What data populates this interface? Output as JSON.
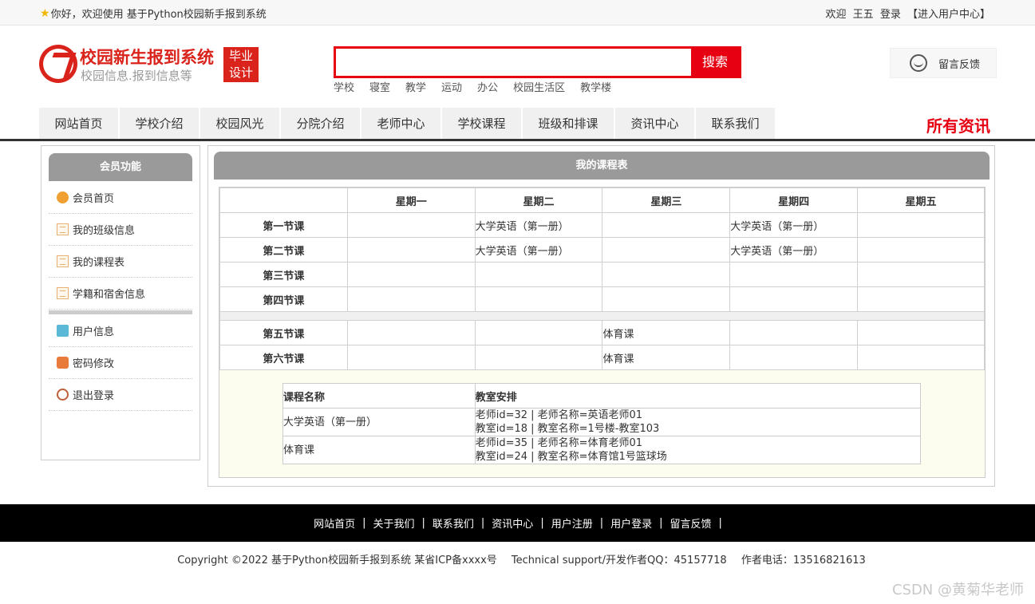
{
  "topbar": {
    "welcome": "你好，欢迎使用 基于Python校园新手报到系统",
    "greeting": "欢迎",
    "username": "王五",
    "login": "登录",
    "user_center": "【进入用户中心】"
  },
  "header": {
    "logo_title": "校园新生报到系统",
    "logo_subtitle": "校园信息.报到信息等",
    "badge_line1": "毕业",
    "badge_line2": "设计",
    "search_value": "",
    "search_button": "搜索",
    "hotwords": [
      "学校",
      "寝室",
      "教学",
      "运动",
      "办公",
      "校园生活区",
      "教学楼"
    ],
    "feedback": "留言反馈"
  },
  "nav": {
    "items": [
      "网站首页",
      "学校介绍",
      "校园风光",
      "分院介绍",
      "老师中心",
      "学校课程",
      "班级和排课",
      "资讯中心",
      "联系我们"
    ],
    "all_news": "所有资讯"
  },
  "sidebar": {
    "title": "会员功能",
    "items": [
      "会员首页",
      "我的班级信息",
      "我的课程表",
      "学籍和宿舍信息",
      "用户信息",
      "密码修改",
      "退出登录"
    ]
  },
  "main": {
    "title": "我的课程表",
    "days": [
      "星期一",
      "星期二",
      "星期三",
      "星期四",
      "星期五"
    ],
    "rows": [
      {
        "label": "第一节课",
        "cells": [
          "",
          "大学英语（第一册）",
          "",
          "大学英语（第一册）",
          ""
        ]
      },
      {
        "label": "第二节课",
        "cells": [
          "",
          "大学英语（第一册）",
          "",
          "大学英语（第一册）",
          ""
        ]
      },
      {
        "label": "第三节课",
        "cells": [
          "",
          "",
          "",
          "",
          ""
        ]
      },
      {
        "label": "第四节课",
        "cells": [
          "",
          "",
          "",
          "",
          ""
        ]
      },
      {
        "label": "第五节课",
        "cells": [
          "",
          "",
          "体育课",
          "",
          ""
        ]
      },
      {
        "label": "第六节课",
        "cells": [
          "",
          "",
          "体育课",
          "",
          ""
        ]
      }
    ],
    "detail_headers": [
      "课程名称",
      "教室安排"
    ],
    "detail_rows": [
      {
        "course": "大学英语（第一册）",
        "line1": "老师id=32 | 老师名称=英语老师01",
        "line2": "教室id=18 | 教室名称=1号楼-教室103"
      },
      {
        "course": "体育课",
        "line1": "老师id=35 | 老师名称=体育老师01",
        "line2": "教室id=24 | 教室名称=体育馆1号篮球场"
      }
    ]
  },
  "footer": {
    "links": [
      "网站首页",
      "关于我们",
      "联系我们",
      "资讯中心",
      "用户注册",
      "用户登录",
      "留言反馈"
    ],
    "separator": "|",
    "copyright": "Copyright ©2022 基于Python校园新手报到系统 某省ICP备xxxx号",
    "support": "Technical support/开发作者QQ：45157718",
    "phone": "作者电话：13516821613"
  },
  "watermark": "CSDN @黄菊华老师"
}
